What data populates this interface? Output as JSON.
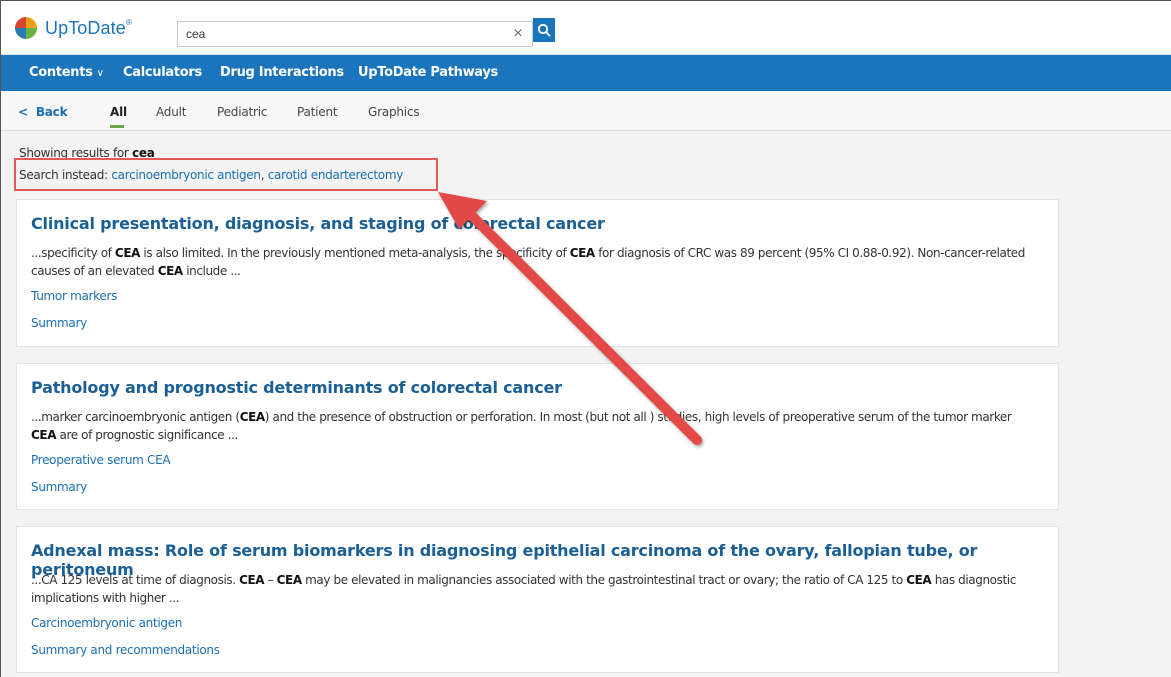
{
  "header": {
    "logo_text": "UpToDate",
    "logo_mark": "®",
    "search_value": "cea",
    "clear_icon": "×"
  },
  "nav": {
    "items": [
      {
        "label": "Contents",
        "has_caret": true
      },
      {
        "label": "Calculators"
      },
      {
        "label": "Drug Interactions"
      },
      {
        "label": "UpToDate Pathways"
      }
    ],
    "caret": "∨"
  },
  "tabs": {
    "back": "Back",
    "back_icon": "<",
    "items": [
      "All",
      "Adult",
      "Pediatric",
      "Patient",
      "Graphics"
    ],
    "active": "All"
  },
  "results": {
    "showing_prefix": "Showing results for",
    "query": "cea",
    "search_instead_prefix": "Search instead:",
    "alt1": "carcinoembryonic antigen",
    "separator": ",",
    "alt2": "carotid endarterectomy"
  },
  "cards": [
    {
      "title": "Clinical presentation, diagnosis, and staging of colorectal cancer",
      "snippet_parts": [
        "...specificity of ",
        "CEA",
        " is also limited. In the previously mentioned meta-analysis, the specificity of ",
        "CEA",
        " for diagnosis of CRC was 89 percent (95% CI 0.88-0.92). Non-cancer-related causes of an elevated ",
        "CEA",
        " include ..."
      ],
      "links": [
        "Tumor markers",
        "Summary"
      ]
    },
    {
      "title": "Pathology and prognostic determinants of colorectal cancer",
      "snippet_parts": [
        "...marker carcinoembryonic antigen (",
        "CEA",
        ") and the presence of obstruction or perforation. In most (but not all ) studies, high levels of preoperative serum of the tumor marker ",
        "CEA",
        " are of prognostic significance ..."
      ],
      "links": [
        "Preoperative serum CEA",
        "Summary"
      ]
    },
    {
      "title": "Adnexal mass: Role of serum biomarkers in diagnosing epithelial carcinoma of the ovary, fallopian tube, or peritoneum",
      "snippet_parts": [
        "...CA 125 levels at time of diagnosis. ",
        "CEA",
        " – ",
        "CEA",
        " may be elevated in malignancies associated with the gastrointestinal tract or ovary; the ratio of CA 125 to ",
        "CEA",
        " has diagnostic implications with higher ..."
      ],
      "links": [
        "Carcinoembryonic antigen",
        "Summary and recommendations"
      ]
    }
  ],
  "colors": {
    "brand_blue": "#1b75bc",
    "link_blue": "#1b6fb0",
    "annotation_red": "#e05a55",
    "active_tab_underline": "#6aa84f"
  },
  "icons": {
    "search": "search-icon",
    "clear": "close-icon",
    "back": "chevron-left-icon",
    "dropdown": "chevron-down-icon"
  }
}
